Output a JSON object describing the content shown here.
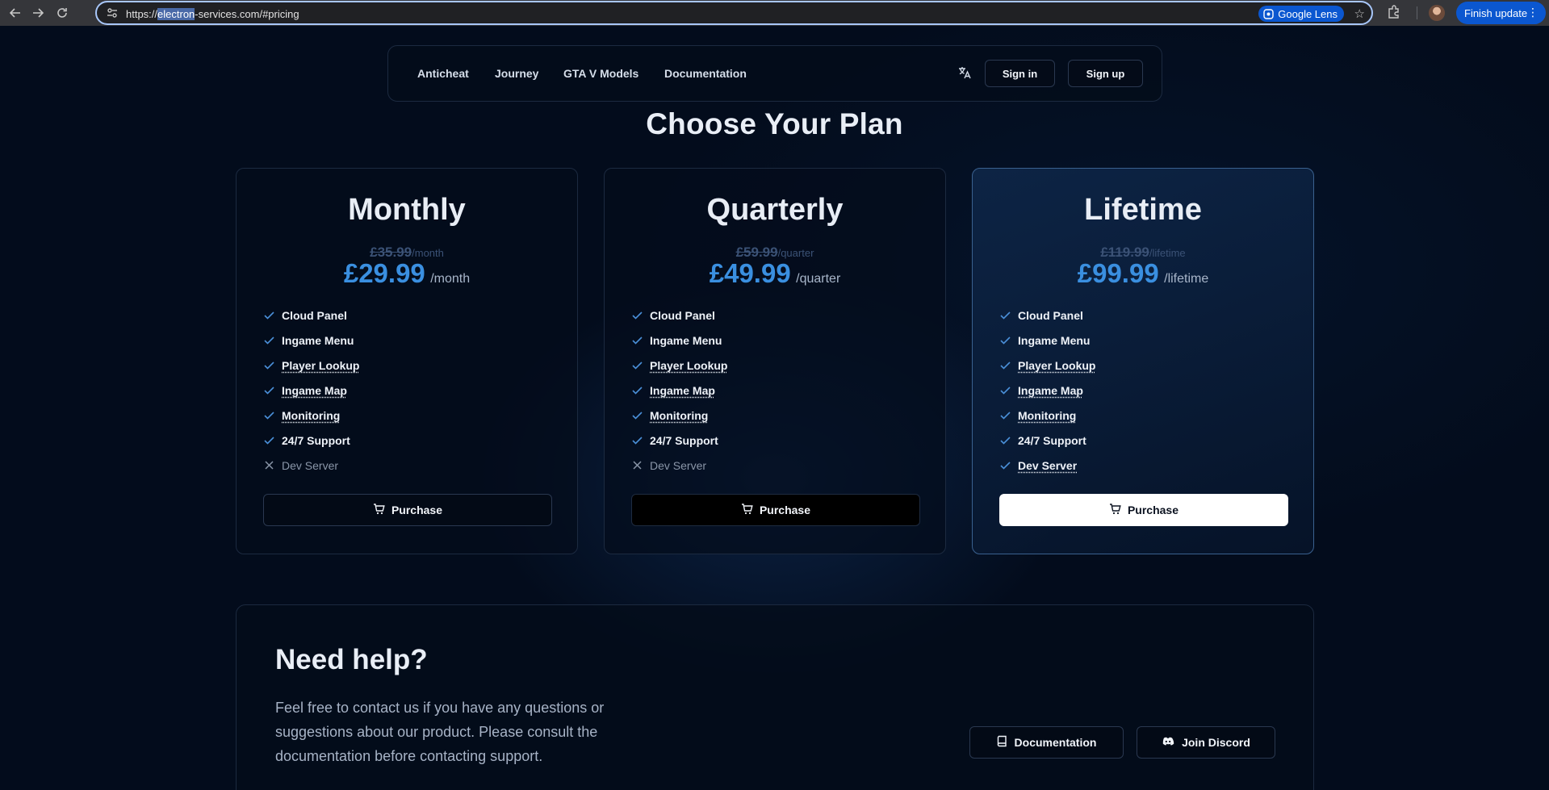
{
  "browser": {
    "url_prefix": "https://",
    "url_highlight": "electron",
    "url_suffix": "-services.com/#pricing",
    "lens_label": "Google Lens",
    "finish_update_label": "Finish update"
  },
  "nav": {
    "links": [
      "Anticheat",
      "Journey",
      "GTA V Models",
      "Documentation"
    ],
    "sign_in": "Sign in",
    "sign_up": "Sign up"
  },
  "headline": "Choose Your Plan",
  "plans": [
    {
      "name": "Monthly",
      "old_price": "£35.99",
      "old_period": "/month",
      "price": "£29.99",
      "period": "/month",
      "features": [
        {
          "label": "Cloud Panel",
          "included": true
        },
        {
          "label": "Ingame Menu",
          "included": true
        },
        {
          "label": "Player Lookup",
          "included": true
        },
        {
          "label": "Ingame Map",
          "included": true
        },
        {
          "label": "Monitoring",
          "included": true
        },
        {
          "label": "24/7 Support",
          "included": true
        },
        {
          "label": "Dev Server",
          "included": false
        }
      ],
      "button": "Purchase"
    },
    {
      "name": "Quarterly",
      "old_price": "£59.99",
      "old_period": "/quarter",
      "price": "£49.99",
      "period": "/quarter",
      "features": [
        {
          "label": "Cloud Panel",
          "included": true
        },
        {
          "label": "Ingame Menu",
          "included": true
        },
        {
          "label": "Player Lookup",
          "included": true
        },
        {
          "label": "Ingame Map",
          "included": true
        },
        {
          "label": "Monitoring",
          "included": true
        },
        {
          "label": "24/7 Support",
          "included": true
        },
        {
          "label": "Dev Server",
          "included": false
        }
      ],
      "button": "Purchase"
    },
    {
      "name": "Lifetime",
      "old_price": "£119.99",
      "old_period": "/lifetime",
      "price": "£99.99",
      "period": "/lifetime",
      "features": [
        {
          "label": "Cloud Panel",
          "included": true
        },
        {
          "label": "Ingame Menu",
          "included": true
        },
        {
          "label": "Player Lookup",
          "included": true
        },
        {
          "label": "Ingame Map",
          "included": true
        },
        {
          "label": "Monitoring",
          "included": true
        },
        {
          "label": "24/7 Support",
          "included": true
        },
        {
          "label": "Dev Server",
          "included": true
        }
      ],
      "button": "Purchase"
    }
  ],
  "help": {
    "title": "Need help?",
    "body": "Feel free to contact us if you have any questions or suggestions about our product. Please consult the documentation before contacting support.",
    "documentation_button": "Documentation",
    "discord_button": "Join Discord"
  },
  "colors": {
    "background": "#030c1c",
    "accent_price": "#3a8fe0",
    "check": "#4a8fd8",
    "chrome_blue": "#0b57d0"
  }
}
